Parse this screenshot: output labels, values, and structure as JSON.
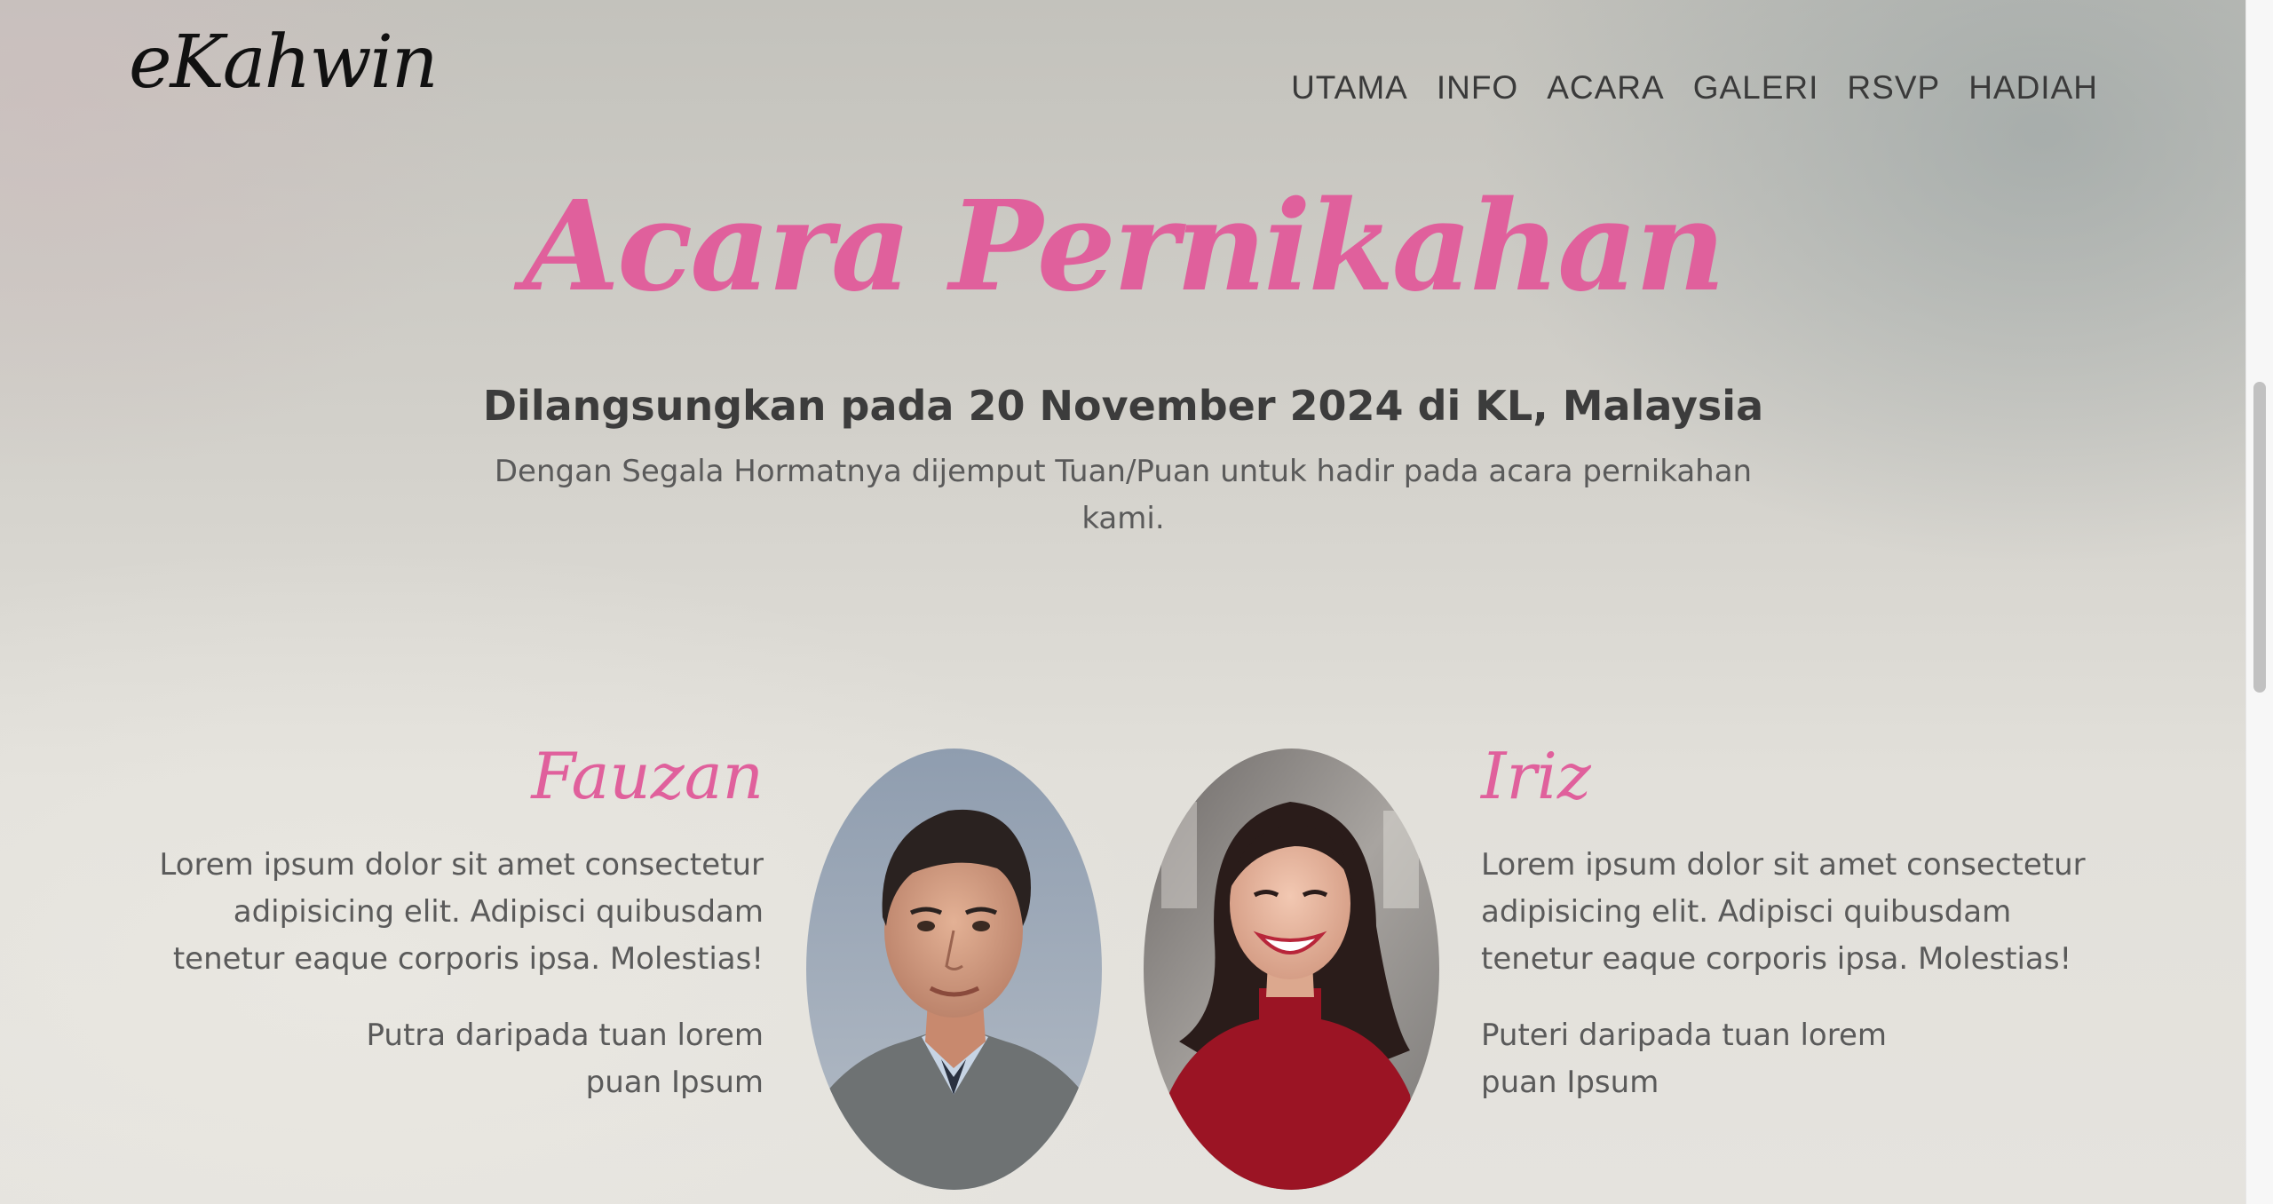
{
  "header": {
    "logo": "eKahwin",
    "nav": [
      "UTAMA",
      "INFO",
      "ACARA",
      "GALERI",
      "RSVP",
      "HADIAH"
    ]
  },
  "hero": {
    "title": "Acara Pernikahan",
    "subtitle": "Dilangsungkan pada 20 November 2024 di KL, Malaysia",
    "text": "Dengan Segala Hormatnya dijemput Tuan/Puan untuk hadir pada acara pernikahan kami."
  },
  "couple": {
    "groom": {
      "name": "Fauzan",
      "description": "Lorem ipsum dolor sit amet consectetur adipisicing elit. Adipisci quibusdam tenetur eaque corporis ipsa. Molestias!",
      "parent_line_1": "Putra daripada tuan lorem",
      "parent_line_2": "puan Ipsum"
    },
    "bride": {
      "name": "Iriz",
      "description": "Lorem ipsum dolor sit amet consectetur adipisicing elit. Adipisci quibusdam tenetur eaque corporis ipsa. Molestias!",
      "parent_line_1": "Puteri daripada tuan lorem",
      "parent_line_2": "puan Ipsum"
    }
  },
  "colors": {
    "accent": "#e0609c",
    "text_dark": "#3c3c3c",
    "text_muted": "#5a5a5a"
  }
}
